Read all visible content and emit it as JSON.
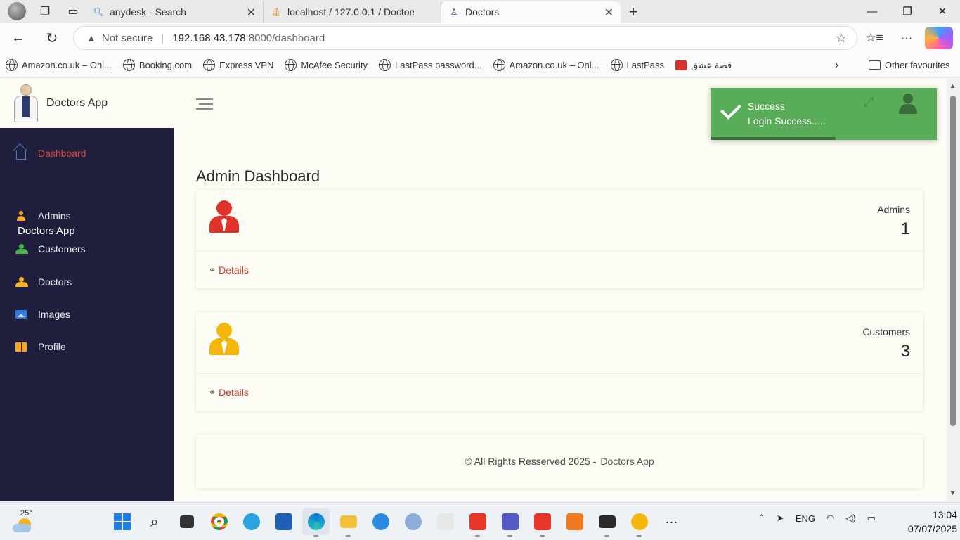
{
  "browser": {
    "tabs": [
      {
        "title": "anydesk - Search",
        "favicon": "search-icon"
      },
      {
        "title": "localhost / 127.0.0.1 / Doctors",
        "favicon": "phpmyadmin-icon"
      },
      {
        "title": "Doctors",
        "favicon": "doctor-icon",
        "active": true
      }
    ],
    "url": {
      "warning": "Not secure",
      "host": "192.168.43.178",
      "path": ":8000/dashboard"
    },
    "bookmarks": [
      "Amazon.co.uk – Onl...",
      "Booking.com",
      "Express VPN",
      "McAfee Security",
      "LastPass password...",
      "Amazon.co.uk – Onl...",
      "LastPass",
      "قصة عشق"
    ],
    "other_favourites": "Other favourites"
  },
  "app": {
    "brand": "Doctors App",
    "sidebar": {
      "items": [
        {
          "label": "Dashboard",
          "icon": "home-icon",
          "active": true
        },
        {
          "label": "Admins",
          "icon": "user-icon"
        },
        {
          "label": "Customers",
          "icon": "users-icon"
        },
        {
          "label": "Doctors",
          "icon": "users-icon"
        },
        {
          "label": "Images",
          "icon": "image-icon"
        },
        {
          "label": "Profile",
          "icon": "book-icon"
        }
      ],
      "brand": "Doctors App"
    },
    "page_title": "Admin Dashboard",
    "cards": [
      {
        "label": "Admins",
        "value": "1",
        "link": "Details",
        "icon_color": "#e0332b"
      },
      {
        "label": "Customers",
        "value": "3",
        "link": "Details",
        "icon_color": "#f5b60b"
      }
    ],
    "footer": {
      "copyright": "© All Rights Resserved 2025 -",
      "brand": "Doctors App"
    },
    "toast": {
      "title": "Success",
      "message": "Login Success.....",
      "color": "#5aad58"
    }
  },
  "taskbar": {
    "temperature": "25°",
    "lang": "ENG",
    "time": "13:04",
    "date": "07/07/2025"
  }
}
